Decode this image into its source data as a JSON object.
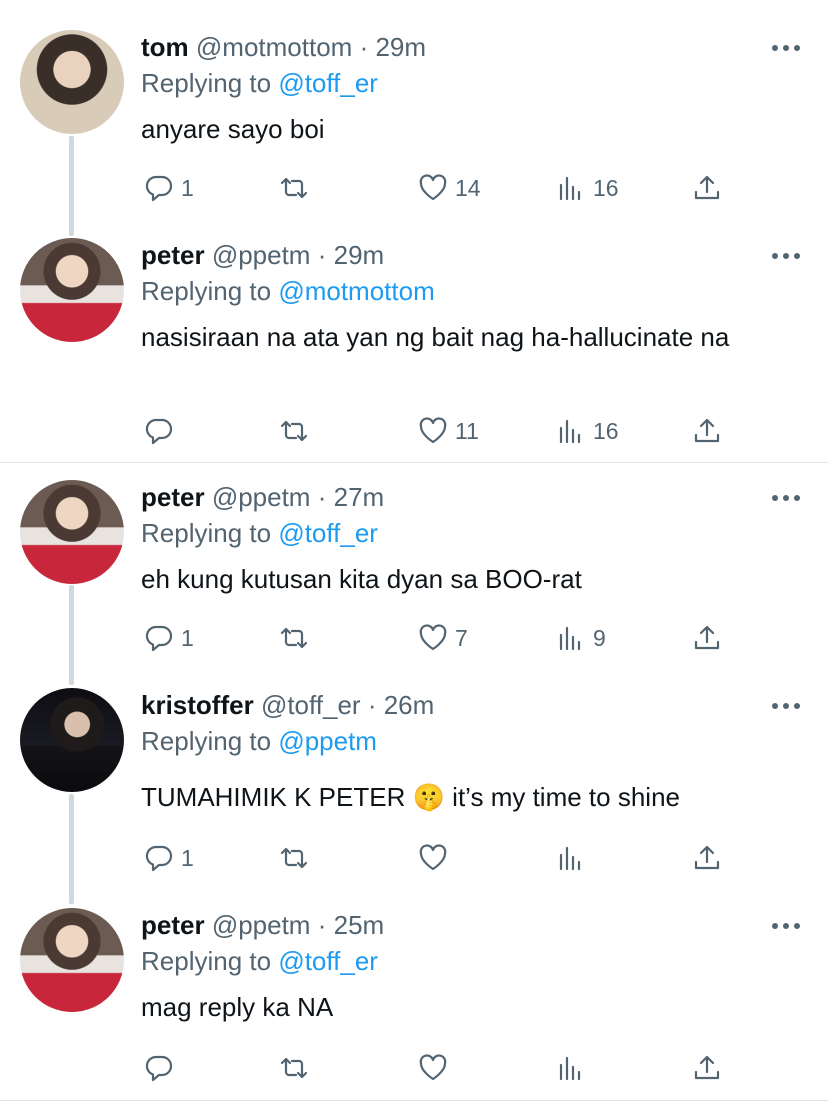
{
  "tweets": [
    {
      "name": "tom",
      "handle": "@motmottom",
      "sep": "·",
      "time": "29m",
      "replying_prefix": "Replying to",
      "mention": "@toff_er",
      "text": "anyare sayo boi",
      "replies": "1",
      "retweets": "",
      "likes": "14",
      "views": "16"
    },
    {
      "name": "peter",
      "handle": "@ppetm",
      "sep": "·",
      "time": "29m",
      "replying_prefix": "Replying to",
      "mention": "@motmottom",
      "text": "nasisiraan na ata yan ng bait nag ha-hallucinate na",
      "replies": "",
      "retweets": "",
      "likes": "11",
      "views": "16"
    },
    {
      "name": "peter",
      "handle": "@ppetm",
      "sep": "·",
      "time": "27m",
      "replying_prefix": "Replying to",
      "mention": "@toff_er",
      "text": "eh kung kutusan kita dyan sa BOO-rat",
      "replies": "1",
      "retweets": "",
      "likes": "7",
      "views": "9"
    },
    {
      "name": "kristoffer",
      "handle": "@toff_er",
      "sep": "·",
      "time": "26m",
      "replying_prefix": "Replying to",
      "mention": "@ppetm",
      "text": "TUMAHIMIK K PETER 🤫  it’s my time to shine",
      "replies": "1",
      "retweets": "",
      "likes": "",
      "views": ""
    },
    {
      "name": "peter",
      "handle": "@ppetm",
      "sep": "·",
      "time": "25m",
      "replying_prefix": "Replying to",
      "mention": "@toff_er",
      "text": "mag reply ka NA",
      "replies": "",
      "retweets": "",
      "likes": "",
      "views": ""
    }
  ],
  "icons": {
    "reply": "reply-icon",
    "retweet": "retweet-icon",
    "like": "heart-icon",
    "views": "views-icon",
    "share": "share-icon",
    "more": "more-icon"
  },
  "colors": {
    "mention": "#1d9bf0",
    "secondary_text": "#536471",
    "primary_text": "#0f1419",
    "thread_line": "#cfd9de"
  }
}
